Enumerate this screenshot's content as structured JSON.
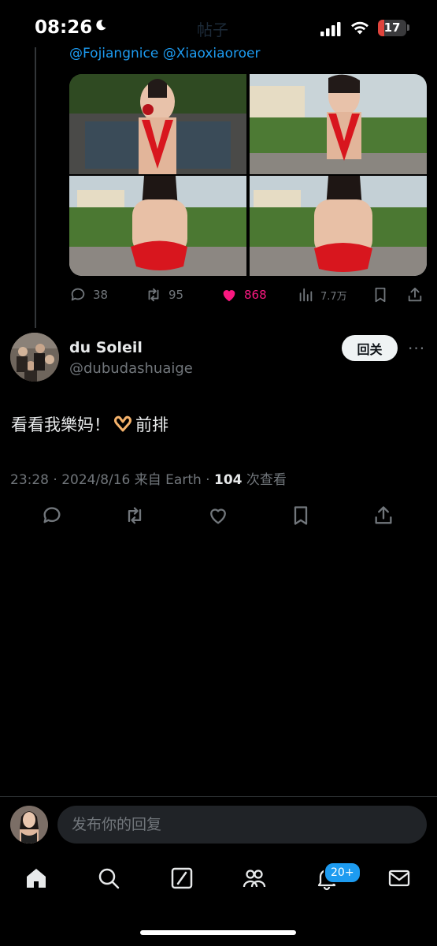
{
  "status_bar": {
    "time": "08:26",
    "battery": "17"
  },
  "header": {
    "title": "帖子"
  },
  "previous_tweet": {
    "mentions": "@Fojiangnice @Xiaoxiaoroer",
    "stats": {
      "replies": "38",
      "retweets": "95",
      "likes": "868",
      "views": "7.7万"
    }
  },
  "reply_tweet": {
    "name": "du Soleil",
    "handle": "@dubudashuaige",
    "follow_label": "回关",
    "text_before": "看看我樂妈！",
    "text_after": "前排",
    "time_meta": "23:28 · 2024/8/16 来自 Earth · ",
    "views_count": "104",
    "views_label": " 次查看"
  },
  "composer": {
    "placeholder": "发布你的回复"
  },
  "tab_bar": {
    "notifications_badge": "20+"
  },
  "colors": {
    "accent": "#1d9bf0",
    "like": "#f91880",
    "muted": "#71767b"
  }
}
